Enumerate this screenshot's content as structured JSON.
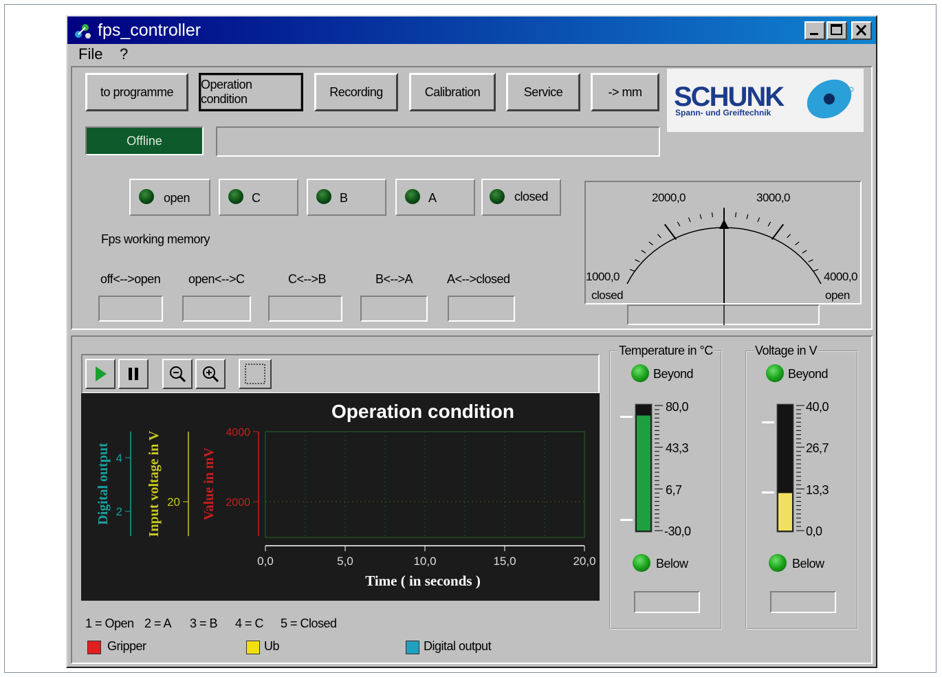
{
  "window": {
    "title": "fps_controller"
  },
  "menu": {
    "file": "File",
    "help": "?"
  },
  "toolbar": {
    "buttons": [
      "to programme",
      "Operation condition",
      "Recording",
      "Calibration",
      "Service",
      "-> mm"
    ],
    "active_index": 1
  },
  "logo": {
    "brand": "SCHUNK",
    "tagline": "Spann- und Greiftechnik"
  },
  "status": {
    "text": "Offline",
    "message": ""
  },
  "indicators": [
    "open",
    "C",
    "B",
    "A",
    "closed"
  ],
  "memory": {
    "title": "Fps working memory",
    "fields": [
      "off<-->open",
      "open<-->C",
      "C<-->B",
      "B<-->A",
      "A<-->closed"
    ],
    "values": [
      "",
      "",
      "",
      "",
      ""
    ]
  },
  "gauge": {
    "tick_labels": [
      "1000,0",
      "2000,0",
      "3000,0",
      "4000,0"
    ],
    "left_label": "closed",
    "right_label": "open",
    "value": 2500,
    "min": 1000,
    "max": 4000
  },
  "chart_data": {
    "type": "line",
    "title": "Operation condition",
    "xlabel": "Time ( in seconds )",
    "x_ticks": [
      "0,0",
      "5,0",
      "10,0",
      "15,0",
      "20,0"
    ],
    "xlim": [
      0,
      20
    ],
    "axes": [
      {
        "label": "Digital output",
        "ticks": [
          "4",
          "2"
        ],
        "color": "#1aa0a0"
      },
      {
        "label": "Input voltage in V",
        "ticks": [
          "20"
        ],
        "color": "#c8c81e"
      },
      {
        "label": "Value in mV",
        "ticks": [
          "4000",
          "2000"
        ],
        "color": "#c81e1e"
      }
    ],
    "grid": true,
    "series": []
  },
  "temperature": {
    "title": "Temperature in °C",
    "beyond": "Beyond",
    "below": "Below",
    "scale": [
      "80,0",
      "43,3",
      "6,7",
      "-30,0"
    ],
    "min": -30,
    "max": 80,
    "fill_fraction": 0.92,
    "fill_color": "#1fa040",
    "value": ""
  },
  "voltage": {
    "title": "Voltage in V",
    "beyond": "Beyond",
    "below": "Below",
    "scale": [
      "40,0",
      "26,7",
      "13,3",
      "0,0"
    ],
    "min": 0,
    "max": 40,
    "fill_fraction": 0.3,
    "fill_color": "#f0e060",
    "value": ""
  },
  "legend": {
    "codes": [
      "1 = Open",
      "2 = A",
      "3 = B",
      "4 = C",
      "5 = Closed"
    ],
    "items": [
      {
        "label": "Gripper",
        "color": "#e02020"
      },
      {
        "label": "Ub",
        "color": "#f0e010"
      },
      {
        "label": "Digital output",
        "color": "#20a0c0"
      }
    ]
  },
  "chart_tools": [
    "play-icon",
    "pause-icon",
    "zoom-out-icon",
    "zoom-in-icon",
    "select-rect-icon"
  ]
}
